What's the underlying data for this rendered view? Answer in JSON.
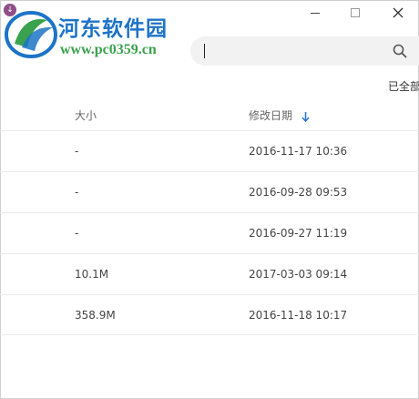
{
  "watermark": {
    "badge": "↓",
    "title": "河东软件园",
    "url": "www.pc0359.cn"
  },
  "window": {
    "minimize_icon": "minimize-icon",
    "maximize_icon": "maximize-icon",
    "close_icon": "close-icon"
  },
  "search": {
    "value": "",
    "icon": "search-icon"
  },
  "toolbar": {
    "selected_all": "已全部"
  },
  "table": {
    "columns": {
      "size": "大小",
      "date": "修改日期"
    },
    "sort": {
      "column": "date",
      "direction": "desc",
      "icon": "arrow-down-icon",
      "color": "#2b7bd6"
    },
    "rows": [
      {
        "size": "-",
        "date": "2016-11-17 10:36"
      },
      {
        "size": "-",
        "date": "2016-09-28 09:53"
      },
      {
        "size": "-",
        "date": "2016-09-27 11:19"
      },
      {
        "size": "10.1M",
        "date": "2017-03-03 09:14"
      },
      {
        "size": "358.9M",
        "date": "2016-11-18 10:17"
      }
    ]
  },
  "colors": {
    "watermark_title": "#1d74c7",
    "watermark_url": "#3aa24f",
    "search_bg": "#f2f2f2"
  }
}
